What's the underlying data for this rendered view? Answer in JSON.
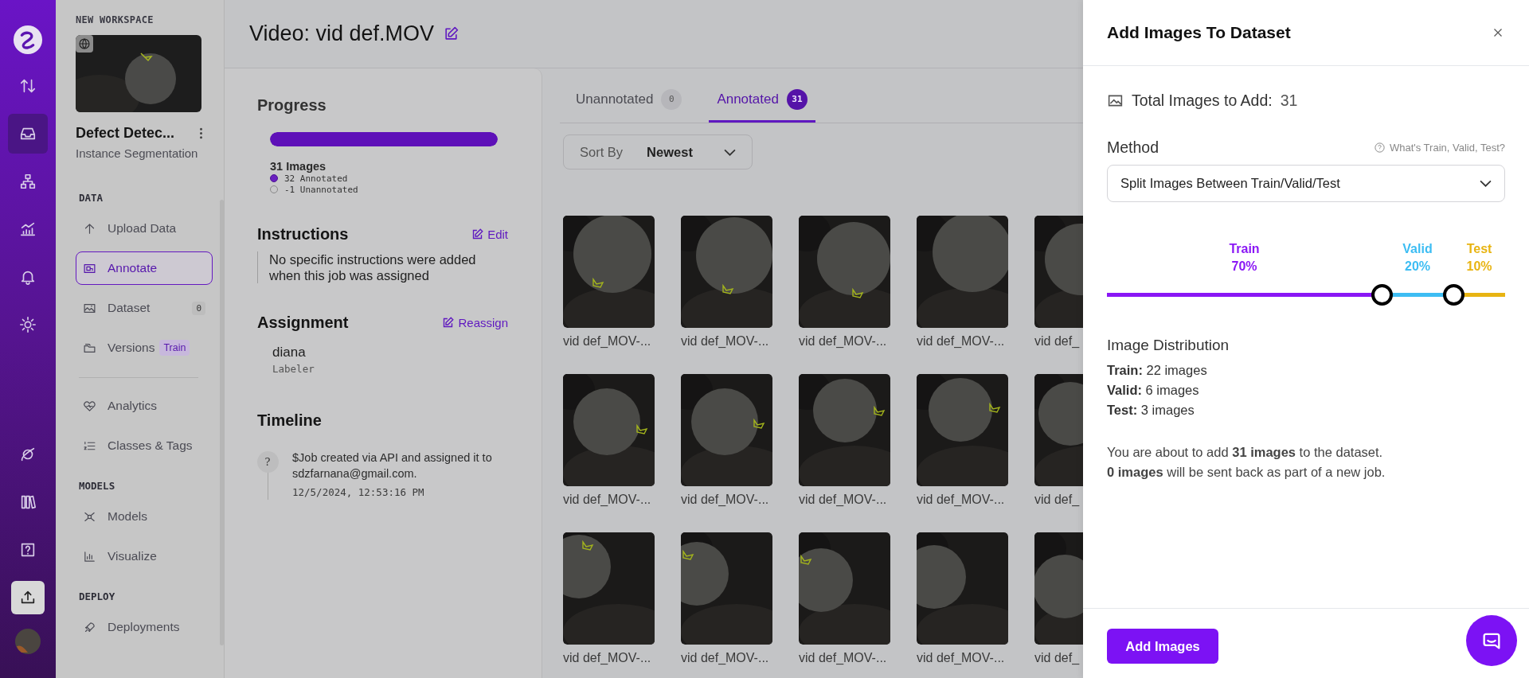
{
  "rail": {
    "top": [
      {
        "selected": false
      },
      {
        "selected": true
      },
      {
        "selected": false
      },
      {
        "selected": false
      },
      {
        "selected": false
      },
      {
        "selected": false
      }
    ],
    "bottom": [
      {
        "selected": false
      },
      {
        "selected": false
      },
      {
        "selected": false
      },
      {
        "selected": true
      }
    ]
  },
  "workspace": {
    "label": "NEW WORKSPACE",
    "project_name": "Defect Detec...",
    "project_type": "Instance Segmentation"
  },
  "sidebar": {
    "sections": [
      {
        "heading": "DATA",
        "items": [
          {
            "label": "Upload Data",
            "selected": false
          },
          {
            "label": "Annotate",
            "selected": true
          },
          {
            "label": "Dataset",
            "selected": false,
            "badge": "0"
          },
          {
            "label": "Versions",
            "selected": false,
            "tag": "Train"
          },
          {
            "label": "Analytics",
            "selected": false,
            "divider_before": true
          },
          {
            "label": "Classes & Tags",
            "selected": false
          }
        ]
      },
      {
        "heading": "MODELS",
        "items": [
          {
            "label": "Models",
            "selected": false
          },
          {
            "label": "Visualize",
            "selected": false
          }
        ]
      },
      {
        "heading": "DEPLOY",
        "items": [
          {
            "label": "Deployments",
            "selected": false
          }
        ]
      }
    ]
  },
  "header": {
    "title": "Video: vid def.MOV"
  },
  "job": {
    "progress": {
      "heading": "Progress",
      "level": 1,
      "count": "31 Images",
      "legend": [
        {
          "kind": "annotated",
          "text": "32 Annotated"
        },
        {
          "kind": "unannotated",
          "text": "-1 Unannotated"
        }
      ]
    },
    "instructions": {
      "heading": "Instructions",
      "action": "Edit",
      "text": "No specific instructions were added when this job was assigned"
    },
    "assignment": {
      "heading": "Assignment",
      "action": "Reassign",
      "name": "diana",
      "role": "Labeler"
    },
    "timeline": {
      "heading": "Timeline",
      "events": [
        {
          "icon": "?",
          "text": "$Job created via API and assigned it to sdzfarnana@gmail.com.",
          "time": "12/5/2024, 12:53:16 PM"
        }
      ]
    }
  },
  "tabs": [
    {
      "label": "Unannotated",
      "count": "0",
      "selected": false
    },
    {
      "label": "Annotated",
      "count": "31",
      "selected": true
    }
  ],
  "sort": {
    "label": "Sort By",
    "value": "Newest"
  },
  "images": [
    {
      "label": "vid def_MOV-..."
    },
    {
      "label": "vid def_MOV-..."
    },
    {
      "label": "vid def_MOV-..."
    },
    {
      "label": "vid def_MOV-..."
    },
    {
      "label": "vid def_"
    },
    {
      "label": "vid def_MOV-..."
    },
    {
      "label": "vid def_MOV-..."
    },
    {
      "label": "vid def_MOV-..."
    },
    {
      "label": "vid def_MOV-..."
    },
    {
      "label": "vid def_"
    },
    {
      "label": "vid def_MOV-..."
    },
    {
      "label": "vid def_MOV-..."
    },
    {
      "label": "vid def_MOV-..."
    },
    {
      "label": "vid def_MOV-..."
    },
    {
      "label": "vid def_"
    }
  ],
  "drawer": {
    "title": "Add Images To Dataset",
    "total_label": "Total Images to Add:",
    "total": "31",
    "method_label": "Method",
    "help": "What's Train, Valid, Test?",
    "method": "Split Images Between Train/Valid/Test",
    "splits": [
      {
        "name": "Train",
        "percent": "70%",
        "color": "#8a17f5"
      },
      {
        "name": "Valid",
        "percent": "20%",
        "color": "#3dbdf3"
      },
      {
        "name": "Test",
        "percent": "10%",
        "color": "#e8b412"
      }
    ],
    "handles": [
      {
        "level": 0.69
      },
      {
        "level": 0.87
      }
    ],
    "distribution": {
      "heading": "Image Distribution",
      "lines": [
        "**Train:** 22 images",
        "**Valid:** 6 images",
        "**Test:** 3 images"
      ]
    },
    "summary": [
      "You are about to add **31 images** to the dataset.",
      "**0 images** will be sent back as part of a new job."
    ],
    "button": "Add Images"
  }
}
